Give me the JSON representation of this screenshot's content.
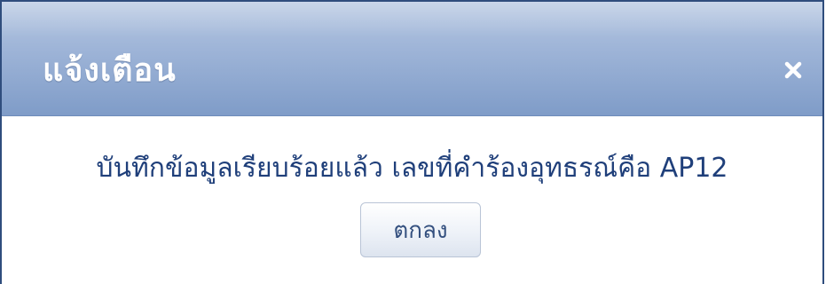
{
  "dialog": {
    "title": "แจ้งเตือน",
    "close_icon": "close-icon",
    "message": "บันทึกข้อมูลเรียบร้อยแล้ว เลขที่คำร้องอุทธรณ์คือ AP12",
    "ok_label": "ตกลง"
  },
  "colors": {
    "titlebar": "#8fa8d0",
    "message_text": "#1f3f7a",
    "border": "#2f4d7d"
  }
}
